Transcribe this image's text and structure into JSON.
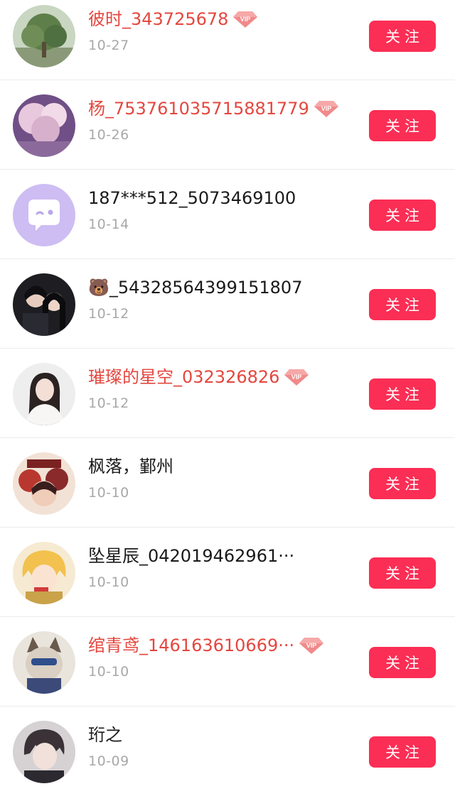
{
  "follow_label": "关注",
  "vip_badge_text": "VIP",
  "colors": {
    "vip_name": "#e4473f",
    "normal_name": "#1a1a1a",
    "date": "#a8a8a8",
    "follow_button": "#fb2e55",
    "divider": "#ececec"
  },
  "users": [
    {
      "name": "彼时_343725678",
      "date": "10-27",
      "vip": true,
      "avatar": "tree-photo-avatar"
    },
    {
      "name": "杨_753761035715881779",
      "date": "10-26",
      "vip": true,
      "avatar": "blossom-photo-avatar"
    },
    {
      "name": "187***512_5073469100",
      "date": "10-14",
      "vip": false,
      "avatar": "default-chat-bubble-avatar"
    },
    {
      "name": "🐻_54328564399151807",
      "date": "10-12",
      "vip": false,
      "avatar": "couple-photo-avatar"
    },
    {
      "name": "璀璨的星空_032326826",
      "date": "10-12",
      "vip": true,
      "avatar": "woman-portrait-avatar"
    },
    {
      "name": "枫落，鄞州",
      "date": "10-10",
      "vip": false,
      "avatar": "anime-group-avatar"
    },
    {
      "name": "坠星辰_042019462961···",
      "date": "10-10",
      "vip": false,
      "avatar": "anime-blonde-avatar"
    },
    {
      "name": "绾青鸢_146163610669···",
      "date": "10-10",
      "vip": true,
      "avatar": "cat-cartoon-avatar"
    },
    {
      "name": "珩之",
      "date": "10-09",
      "vip": false,
      "avatar": "anime-boy-avatar"
    }
  ]
}
